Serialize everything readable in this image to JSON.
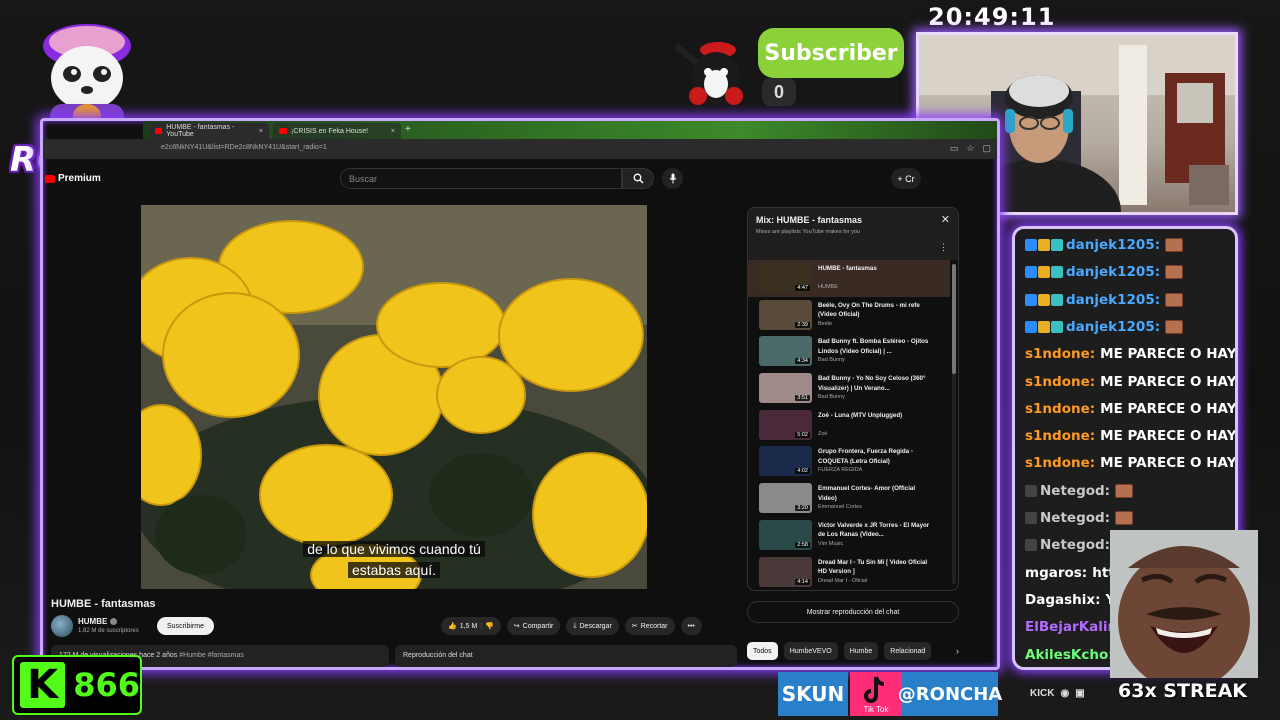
{
  "overlay": {
    "clock": "20:49:11",
    "logo_text": "RONCHAS",
    "subscriber_label": "Subscriber",
    "subscriber_count": "0",
    "kick_count": "866",
    "kick_letter": "K",
    "skun_label": "SKUN",
    "tiktok_label": "Tik Tok",
    "handle": "@RONCHA",
    "kick_label": "KICK",
    "streak": "63x STREAK"
  },
  "browser": {
    "tabs": [
      {
        "label": "HUMBE - fantasmas - YouTube"
      },
      {
        "label": "¡CRISIS en Feka House!"
      }
    ],
    "url": "e2c8NkNY41U&list=RDe2c8NkNY41U&start_radio=1"
  },
  "youtube": {
    "premium_label": "Premium",
    "search_placeholder": "Buscar",
    "create_label": "Cr",
    "video": {
      "caption_line1": "de lo que vivimos cuando tú",
      "caption_line2": "estabas aquí.",
      "title": "HUMBE - fantasmas",
      "channel": "HUMBE",
      "subscribers": "1,82 M de suscriptores",
      "subscribe_label": "Suscribirme",
      "likes": "1,5 M",
      "share_label": "Compartir",
      "download_label": "Descargar",
      "clip_label": "Recortar",
      "views": "172 M de visualizaciones",
      "date": "hace 2 años",
      "tags": "#Humbe #fantasmas",
      "chat_replay": "Reproducción del chat"
    },
    "playlist": {
      "title": "Mix: HUMBE - fantasmas",
      "subtitle": "Mixes are playlists YouTube makes for you",
      "items": [
        {
          "title": "HUMBE - fantasmas",
          "channel": "HUMBE",
          "duration": "4:47",
          "color": "#3a3020"
        },
        {
          "title": "Beéle, Ovy On The Drums - mi refe (Video Oficial)",
          "channel": "Beéle",
          "duration": "2:39",
          "color": "#5a4a3a"
        },
        {
          "title": "Bad Bunny ft. Bomba Estéreo - Ojitos Lindos (Video Oficial) | ...",
          "channel": "Bad Bunny",
          "duration": "4:34",
          "color": "#4a6a6a"
        },
        {
          "title": "Bad Bunny - Yo No Soy Celoso (360° Visualizer) | Un Verano...",
          "channel": "Bad Bunny",
          "duration": "3:51",
          "color": "#a08a8a"
        },
        {
          "title": "Zoé - Luna (MTV Unplugged)",
          "channel": "Zoé",
          "duration": "5:02",
          "color": "#4a2a3a"
        },
        {
          "title": "Grupo Frontera, Fuerza Regida - COQUETA (Letra Oficial)",
          "channel": "FUERZA REGIDA",
          "duration": "4:02",
          "color": "#1a2a4a"
        },
        {
          "title": "Emmanuel Cortes- Amor (Official Video)",
          "channel": "Emmanuel Cortes",
          "duration": "3:20",
          "color": "#8a8a8a"
        },
        {
          "title": "Victor Valverde x JR Torres - El Mayor de Los Ranas (Video...",
          "channel": "Vim Music",
          "duration": "2:58",
          "color": "#2a4a4a"
        },
        {
          "title": "Dread Mar I - Tu Sin Mi [ Video Oficial HD Version ]",
          "channel": "Dread Mar I - Oficial",
          "duration": "4:14",
          "color": "#4a3a3a"
        }
      ],
      "show_chat": "Mostrar reproducción del chat",
      "chips": [
        "Todos",
        "HumbeVEVO",
        "Humbe",
        "Relacionad"
      ]
    }
  },
  "chat": [
    {
      "user": "danjek1205:",
      "message": "",
      "emote": true,
      "cls": "u-danjek"
    },
    {
      "user": "danjek1205:",
      "message": "",
      "emote": true,
      "cls": "u-danjek"
    },
    {
      "user": "danjek1205:",
      "message": "",
      "emote": true,
      "cls": "u-danjek"
    },
    {
      "user": "danjek1205:",
      "message": "",
      "emote": true,
      "cls": "u-danjek"
    },
    {
      "user": "s1ndone:",
      "message": "ME PARECE O HAY",
      "emote": false,
      "cls": "u-s1n"
    },
    {
      "user": "s1ndone:",
      "message": "ME PARECE O HAY",
      "emote": false,
      "cls": "u-s1n"
    },
    {
      "user": "s1ndone:",
      "message": "ME PARECE O HAY",
      "emote": false,
      "cls": "u-s1n"
    },
    {
      "user": "s1ndone:",
      "message": "ME PARECE O HAY",
      "emote": false,
      "cls": "u-s1n"
    },
    {
      "user": "s1ndone:",
      "message": "ME PARECE O HAY",
      "emote": false,
      "cls": "u-s1n"
    },
    {
      "user": "Netegod:",
      "message": "",
      "emote": true,
      "cls": "u-nete"
    },
    {
      "user": "Netegod:",
      "message": "",
      "emote": true,
      "cls": "u-nete"
    },
    {
      "user": "Netegod:",
      "message": "",
      "emote": true,
      "cls": "u-nete"
    },
    {
      "user": "mgaros:",
      "message": "https",
      "emote": false,
      "cls": "u-mg"
    },
    {
      "user": "Dagashix:",
      "message": "Y C",
      "emote": false,
      "cls": "u-dag"
    },
    {
      "user": "ElBejarKalinc",
      "message": "",
      "emote": false,
      "cls": "u-el"
    },
    {
      "user": "AkilesKcho:",
      "message": "",
      "emote": false,
      "cls": "u-ak"
    }
  ]
}
